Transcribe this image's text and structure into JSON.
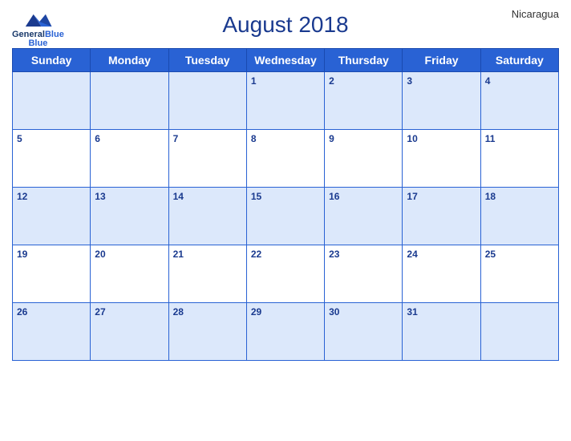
{
  "header": {
    "title": "August 2018",
    "country": "Nicaragua",
    "logo": {
      "line1": "General",
      "line2": "Blue"
    }
  },
  "weekdays": [
    "Sunday",
    "Monday",
    "Tuesday",
    "Wednesday",
    "Thursday",
    "Friday",
    "Saturday"
  ],
  "weeks": [
    [
      null,
      null,
      null,
      1,
      2,
      3,
      4
    ],
    [
      5,
      6,
      7,
      8,
      9,
      10,
      11
    ],
    [
      12,
      13,
      14,
      15,
      16,
      17,
      18
    ],
    [
      19,
      20,
      21,
      22,
      23,
      24,
      25
    ],
    [
      26,
      27,
      28,
      29,
      30,
      31,
      null
    ]
  ]
}
